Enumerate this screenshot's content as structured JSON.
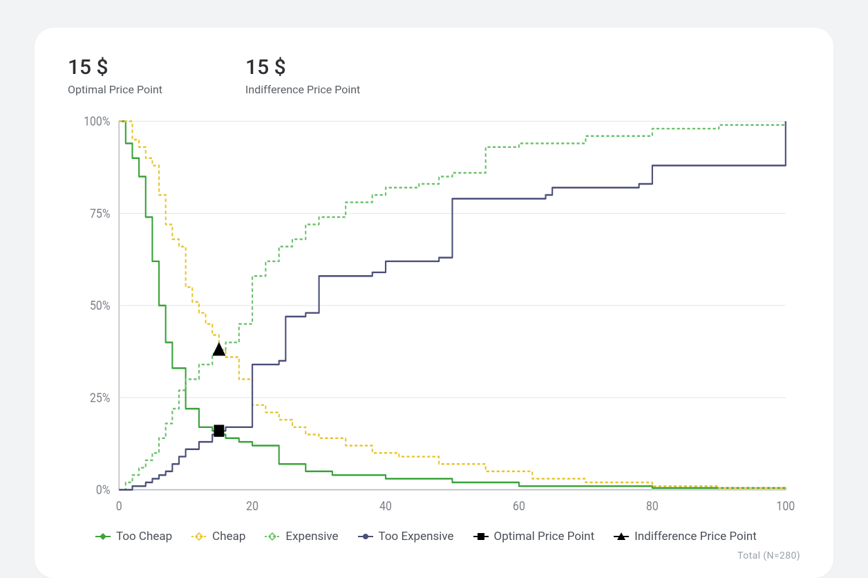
{
  "metrics": {
    "optimal": {
      "value": "15 $",
      "label": "Optimal Price Point"
    },
    "indiff": {
      "value": "15 $",
      "label": "Indifference Price Point"
    }
  },
  "legend": {
    "too_cheap": "Too Cheap",
    "cheap": "Cheap",
    "expensive": "Expensive",
    "too_expensive": "Too Expensive",
    "opp": "Optimal Price Point",
    "ipp": "Indifference Price Point"
  },
  "footer": "Total (N=280)",
  "colors": {
    "too_cheap": "#3aa23a",
    "cheap": "#e7c530",
    "expensive": "#6cc26c",
    "too_expensive": "#4b4e78",
    "marker": "#000000",
    "grid": "#e8e9ec",
    "axis": "#b9bcc2",
    "tick_text": "#7a7f86"
  },
  "axes": {
    "y_ticks": [
      "0%",
      "25%",
      "50%",
      "75%",
      "100%"
    ],
    "x_ticks": [
      "0",
      "20",
      "40",
      "60",
      "80",
      "100"
    ]
  },
  "chart_data": {
    "type": "line",
    "xlabel": "",
    "ylabel": "",
    "xlim": [
      0,
      100
    ],
    "ylim": [
      0,
      100
    ],
    "x_ticks": [
      0,
      20,
      40,
      60,
      80,
      100
    ],
    "y_ticks": [
      0,
      25,
      50,
      75,
      100
    ],
    "series": [
      {
        "name": "Too Cheap",
        "color": "#3aa23a",
        "points": [
          [
            0,
            100
          ],
          [
            1,
            94
          ],
          [
            2,
            90
          ],
          [
            3,
            85
          ],
          [
            4,
            74
          ],
          [
            5,
            62
          ],
          [
            6,
            50
          ],
          [
            7,
            40
          ],
          [
            8,
            33
          ],
          [
            9,
            33
          ],
          [
            10,
            22
          ],
          [
            12,
            17
          ],
          [
            14,
            16
          ],
          [
            15,
            15
          ],
          [
            16,
            14
          ],
          [
            18,
            13
          ],
          [
            20,
            12
          ],
          [
            24,
            7
          ],
          [
            28,
            5
          ],
          [
            32,
            4
          ],
          [
            40,
            3
          ],
          [
            50,
            2
          ],
          [
            60,
            1
          ],
          [
            80,
            0.5
          ],
          [
            100,
            0
          ]
        ]
      },
      {
        "name": "Cheap",
        "color": "#e7c530",
        "points": [
          [
            0,
            100
          ],
          [
            1,
            100
          ],
          [
            2,
            95
          ],
          [
            3,
            93
          ],
          [
            4,
            90
          ],
          [
            5,
            88
          ],
          [
            6,
            80
          ],
          [
            7,
            72
          ],
          [
            8,
            68
          ],
          [
            9,
            66
          ],
          [
            10,
            55
          ],
          [
            11,
            51
          ],
          [
            12,
            48
          ],
          [
            13,
            45
          ],
          [
            14,
            42
          ],
          [
            15,
            38
          ],
          [
            16,
            36
          ],
          [
            18,
            30
          ],
          [
            20,
            23
          ],
          [
            22,
            21
          ],
          [
            24,
            19
          ],
          [
            26,
            17
          ],
          [
            28,
            15
          ],
          [
            30,
            14
          ],
          [
            34,
            12
          ],
          [
            38,
            10
          ],
          [
            42,
            9
          ],
          [
            48,
            7
          ],
          [
            55,
            5
          ],
          [
            62,
            3
          ],
          [
            70,
            2
          ],
          [
            80,
            1
          ],
          [
            90,
            0.5
          ],
          [
            100,
            0
          ]
        ]
      },
      {
        "name": "Expensive",
        "color": "#6cc26c",
        "points": [
          [
            0,
            0
          ],
          [
            1,
            2
          ],
          [
            2,
            4
          ],
          [
            3,
            6
          ],
          [
            4,
            8
          ],
          [
            5,
            10
          ],
          [
            6,
            14
          ],
          [
            7,
            18
          ],
          [
            8,
            22
          ],
          [
            9,
            27
          ],
          [
            10,
            30
          ],
          [
            12,
            34
          ],
          [
            14,
            37
          ],
          [
            15,
            38
          ],
          [
            16,
            40
          ],
          [
            18,
            45
          ],
          [
            20,
            58
          ],
          [
            22,
            62
          ],
          [
            24,
            66
          ],
          [
            26,
            68
          ],
          [
            28,
            72
          ],
          [
            30,
            74
          ],
          [
            34,
            78
          ],
          [
            38,
            80
          ],
          [
            40,
            82
          ],
          [
            45,
            83
          ],
          [
            48,
            85
          ],
          [
            50,
            86
          ],
          [
            55,
            93
          ],
          [
            60,
            94
          ],
          [
            70,
            96
          ],
          [
            80,
            98
          ],
          [
            90,
            99
          ],
          [
            100,
            100
          ]
        ]
      },
      {
        "name": "Too Expensive",
        "color": "#4b4e78",
        "points": [
          [
            0,
            0
          ],
          [
            1,
            0
          ],
          [
            2,
            1
          ],
          [
            3,
            1
          ],
          [
            4,
            2
          ],
          [
            5,
            3
          ],
          [
            6,
            4
          ],
          [
            7,
            5
          ],
          [
            8,
            7
          ],
          [
            9,
            9
          ],
          [
            10,
            11
          ],
          [
            12,
            13
          ],
          [
            14,
            15
          ],
          [
            15,
            16
          ],
          [
            16,
            17
          ],
          [
            18,
            17
          ],
          [
            20,
            34
          ],
          [
            24,
            35
          ],
          [
            25,
            47
          ],
          [
            28,
            48
          ],
          [
            30,
            58
          ],
          [
            38,
            59
          ],
          [
            40,
            62
          ],
          [
            48,
            63
          ],
          [
            50,
            79
          ],
          [
            64,
            80
          ],
          [
            65,
            82
          ],
          [
            78,
            83
          ],
          [
            80,
            88
          ],
          [
            98,
            88
          ],
          [
            100,
            100
          ]
        ]
      }
    ],
    "markers": [
      {
        "name": "Optimal Price Point",
        "shape": "square",
        "x": 15,
        "y": 16
      },
      {
        "name": "Indifference Price Point",
        "shape": "triangle",
        "x": 15,
        "y": 38
      }
    ]
  }
}
